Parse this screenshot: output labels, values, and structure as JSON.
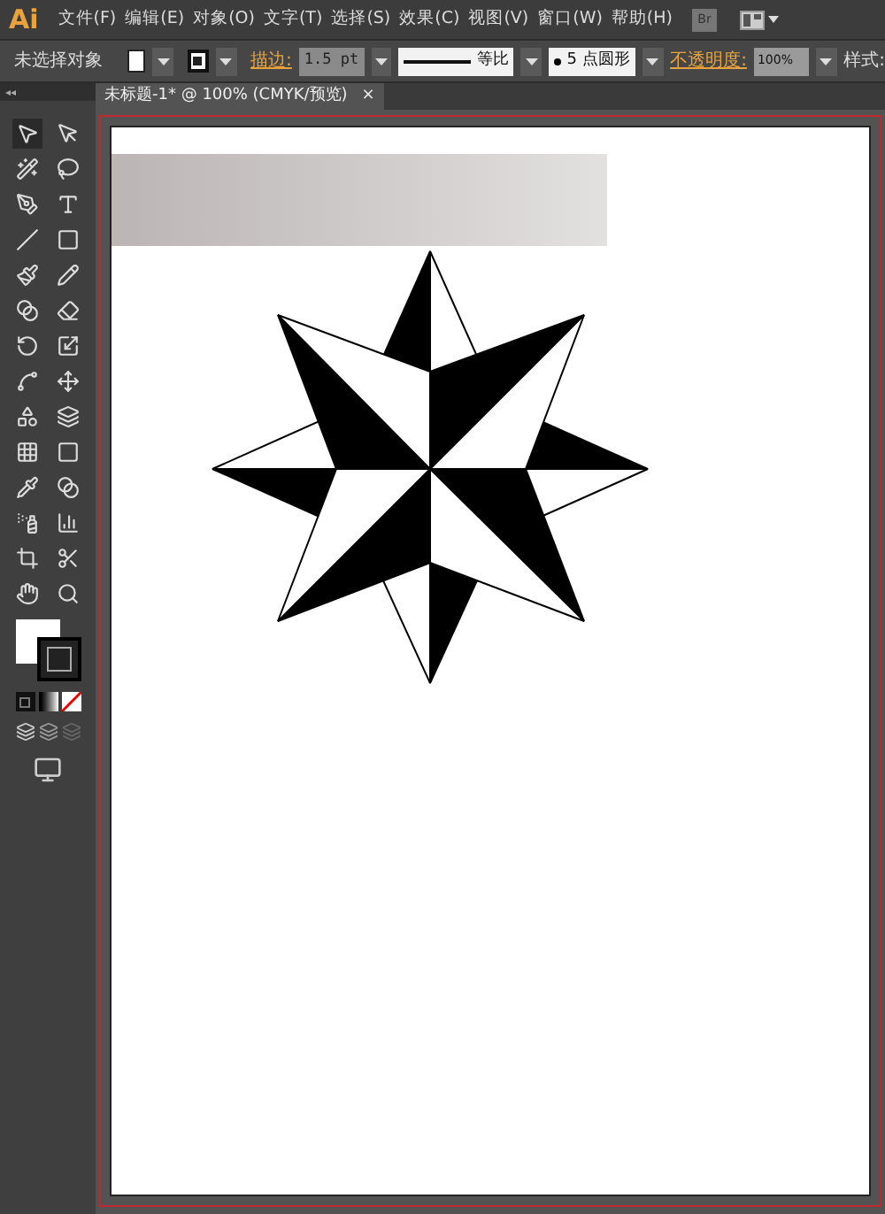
{
  "app": {
    "logo": "Ai",
    "bridge": "Br"
  },
  "menu": [
    "文件(F)",
    "编辑(E)",
    "对象(O)",
    "文字(T)",
    "选择(S)",
    "效果(C)",
    "视图(V)",
    "窗口(W)",
    "帮助(H)"
  ],
  "control_bar": {
    "selection": "未选择对象",
    "stroke_label": "描边:",
    "stroke_weight": "1.5 pt",
    "profile": "等比",
    "brush": "5 点圆形",
    "opacity_label": "不透明度:",
    "opacity": "100%",
    "style_label": "样式:"
  },
  "toolbox": {
    "collapse": "◂◂"
  },
  "document_tab": {
    "title": "未标题-1* @ 100% (CMYK/预览)",
    "close": "×",
    "selected": true
  }
}
